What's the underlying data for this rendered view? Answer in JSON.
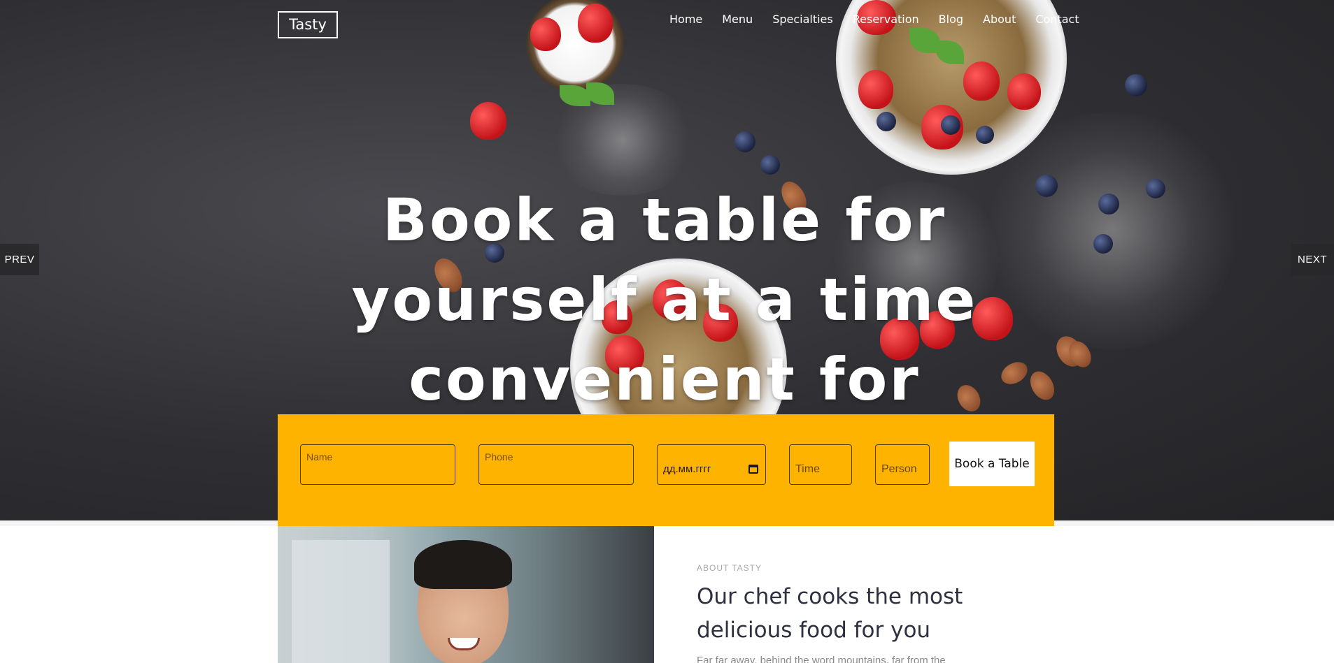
{
  "brand": {
    "name": "Tasty"
  },
  "nav": {
    "items": [
      "Home",
      "Menu",
      "Specialties",
      "Reservation",
      "Blog",
      "About",
      "Contact"
    ]
  },
  "hero": {
    "headline": "Book a table for yourself at a time convenient for you",
    "prev_label": "PREV",
    "next_label": "NEXT"
  },
  "booking": {
    "name_placeholder": "Name",
    "phone_placeholder": "Phone",
    "date_placeholder": "дд.мм.гггг",
    "time_placeholder": "Time",
    "person_placeholder": "Person",
    "submit_label": "Book a Table",
    "bar_color": "#fdb300"
  },
  "about": {
    "kicker": "ABOUT TASTY",
    "title": "Our chef cooks the most delicious food for you",
    "text": "Far far away, behind the word mountains, far from the"
  }
}
